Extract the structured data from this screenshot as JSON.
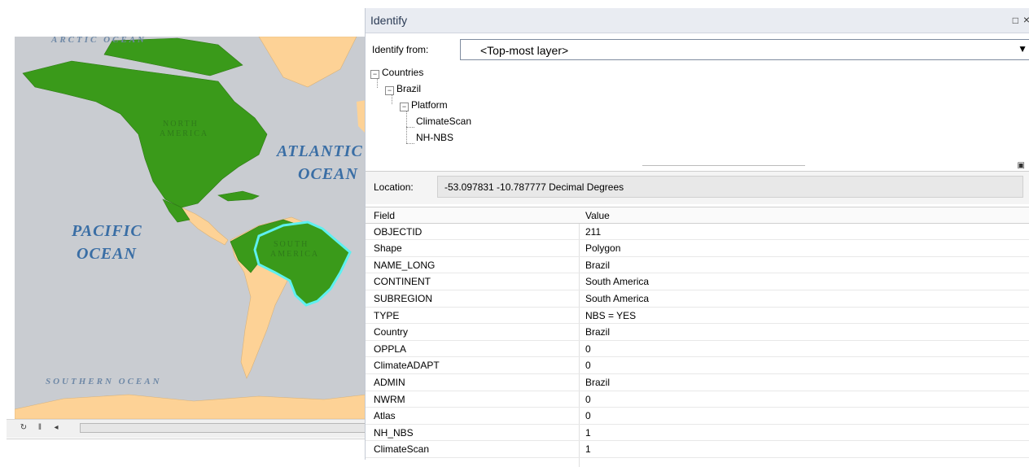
{
  "map": {
    "ocean_labels": {
      "arctic": "ARCTIC OCEAN",
      "atlantic_line1": "ATLANTIC",
      "atlantic_line2": "OCEAN",
      "pacific_line1": "PACIFIC",
      "pacific_line2": "OCEAN",
      "southern": "SOUTHERN OCEAN"
    },
    "continent_labels": {
      "north_line1": "NORTH",
      "north_line2": "AMERICA",
      "south_line1": "SOUTH",
      "south_line2": "AMERICA"
    },
    "colors": {
      "water": "#c9ccd1",
      "selected_fill": "#3a9a1a",
      "other_land": "#fdd296",
      "highlight": "#5ef0f0"
    },
    "toolbar": {
      "refresh_icon": "refresh-icon",
      "pause_icon": "pause-icon",
      "back_icon": "scroll-left-icon"
    }
  },
  "identify": {
    "title": "Identify",
    "from_label": "Identify from:",
    "from_value": "<Top-most layer>",
    "tree": {
      "root": "Countries",
      "country": "Brazil",
      "group": "Platform",
      "leaf1": "ClimateScan",
      "leaf2": "NH-NBS"
    },
    "location_label": "Location:",
    "location_value": "-53.097831  -10.787777 Decimal Degrees",
    "columns": {
      "field": "Field",
      "value": "Value"
    },
    "rows": [
      {
        "field": "OBJECTID",
        "value": "211"
      },
      {
        "field": "Shape",
        "value": "Polygon"
      },
      {
        "field": "NAME_LONG",
        "value": "Brazil"
      },
      {
        "field": "CONTINENT",
        "value": "South America"
      },
      {
        "field": "SUBREGION",
        "value": "South America"
      },
      {
        "field": "TYPE",
        "value": "NBS = YES"
      },
      {
        "field": "Country",
        "value": "Brazil"
      },
      {
        "field": "OPPLA",
        "value": "0"
      },
      {
        "field": "ClimateADAPT",
        "value": "0"
      },
      {
        "field": "ADMIN",
        "value": "Brazil"
      },
      {
        "field": "NWRM",
        "value": "0"
      },
      {
        "field": "Atlas",
        "value": "0"
      },
      {
        "field": "NH_NBS",
        "value": "1"
      },
      {
        "field": "ClimateScan",
        "value": "1"
      }
    ]
  }
}
